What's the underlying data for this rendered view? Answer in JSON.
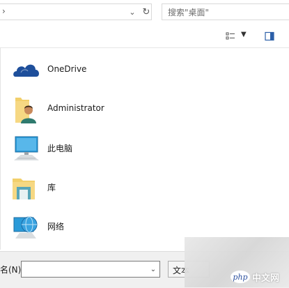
{
  "address_bar": {
    "search_placeholder": "搜索\"桌面\""
  },
  "icons": {
    "address_chevron": "chevron-right-icon",
    "address_dropdown": "chevron-down-icon",
    "refresh": "refresh-icon",
    "view_options": "view-options-icon",
    "preview_pane": "preview-pane-icon"
  },
  "items": [
    {
      "label": "OneDrive",
      "icon": "onedrive-cloud-icon"
    },
    {
      "label": "Administrator",
      "icon": "user-folder-icon"
    },
    {
      "label": "此电脑",
      "icon": "this-pc-icon"
    },
    {
      "label": "库",
      "icon": "library-icon"
    },
    {
      "label": "网络",
      "icon": "network-icon"
    }
  ],
  "bottom": {
    "filename_label": "名(N):",
    "filename_value": "",
    "type_select_label": "文本"
  },
  "watermark": {
    "badge": "php",
    "text": "中文网"
  },
  "colors": {
    "onedrive_blue": "#1e4f9b",
    "folder_yellow": "#f2cf6b",
    "monitor_blue": "#2a9ad8"
  }
}
